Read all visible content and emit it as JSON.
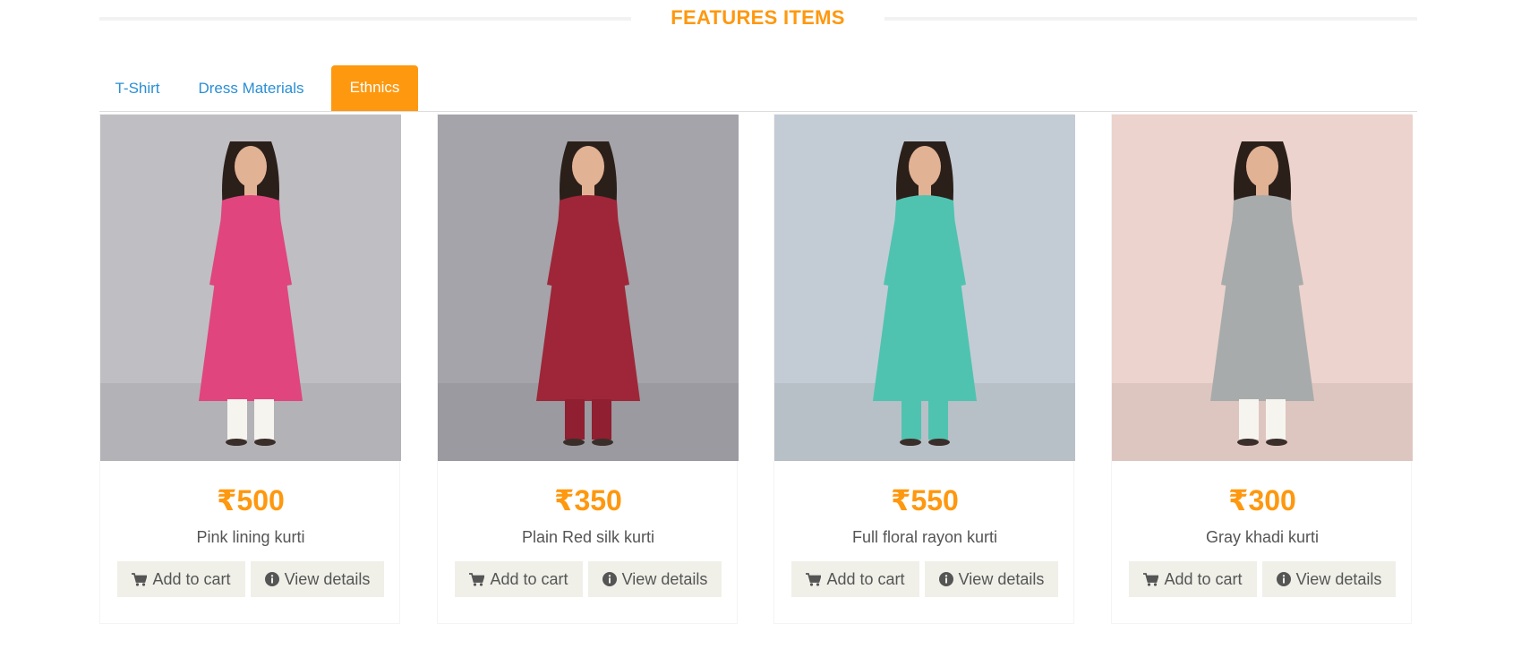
{
  "section": {
    "title": "FEATURES ITEMS"
  },
  "tabs": [
    {
      "label": "T-Shirt",
      "active": false
    },
    {
      "label": "Dress Materials",
      "active": false
    },
    {
      "label": "Ethnics",
      "active": true
    }
  ],
  "products": [
    {
      "price": "₹500",
      "name": "Pink lining kurti",
      "cart_label": "Add to cart",
      "details_label": "View details",
      "bg_color": "#bfbec3",
      "dress_color": "#e0457e",
      "bottom_color": "#f6f4ef"
    },
    {
      "price": "₹350",
      "name": "Plain Red silk kurti",
      "cart_label": "Add to cart",
      "details_label": "View details",
      "bg_color": "#a4a4aa",
      "dress_color": "#9e2638",
      "bottom_color": "#8f1f31"
    },
    {
      "price": "₹550",
      "name": "Full floral rayon kurti",
      "cart_label": "Add to cart",
      "details_label": "View details",
      "bg_color": "#c3ccd4",
      "dress_color": "#4fc3b0",
      "bottom_color": "#4fc3b0"
    },
    {
      "price": "₹300",
      "name": "Gray khadi kurti",
      "cart_label": "Add to cart",
      "details_label": "View details",
      "bg_color": "#ecd3cd",
      "dress_color": "#a8abab",
      "bottom_color": "#f6f4ef"
    }
  ],
  "colors": {
    "accent": "#fe980f",
    "link": "#2a8fd4",
    "button_bg": "#f0f0e9",
    "text": "#555555"
  }
}
